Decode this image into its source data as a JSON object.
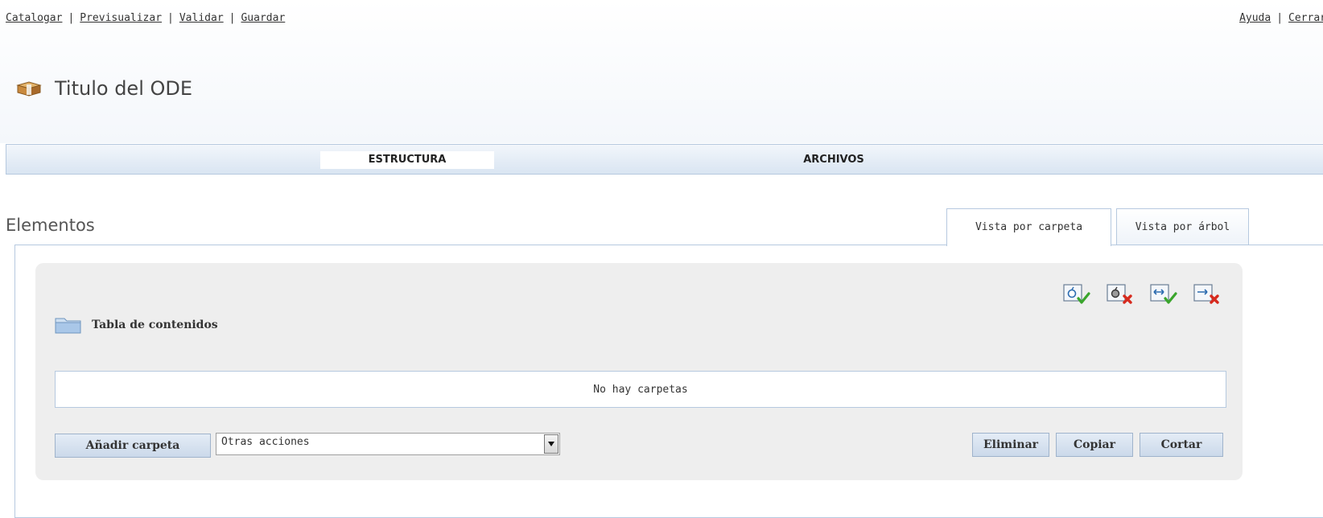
{
  "topnav": {
    "left": [
      "Catalogar",
      "Previsualizar",
      "Validar",
      "Guardar"
    ],
    "right": [
      "Ayuda",
      "Cerrar"
    ]
  },
  "page": {
    "title": "Titulo del ODE"
  },
  "mainnav": {
    "tabs": [
      "ESTRUCTURA",
      "ARCHIVOS"
    ],
    "active": "ESTRUCTURA"
  },
  "section": {
    "title": "Elementos"
  },
  "view_tabs": {
    "folder": "Vista por carpeta",
    "tree": "Vista por árbol",
    "active": "Vista por carpeta"
  },
  "toolbar": {
    "icons": [
      "add-node-icon",
      "remove-node-icon",
      "add-link-icon",
      "remove-link-icon"
    ]
  },
  "toc": {
    "label": "Tabla de contenidos"
  },
  "folders": {
    "empty_message": "No hay carpetas"
  },
  "actions": {
    "add_folder": "Añadir carpeta",
    "other_actions": "Otras acciones",
    "delete": "Eliminar",
    "copy": "Copiar",
    "cut": "Cortar"
  },
  "colors": {
    "accent_border": "#b6c9df",
    "nav_gradient_top": "#f2f6fb",
    "nav_gradient_bottom": "#d9e5f2",
    "panel_bg": "#eeeeee",
    "success_green": "#3aa52c",
    "danger_red": "#d62a1e"
  }
}
